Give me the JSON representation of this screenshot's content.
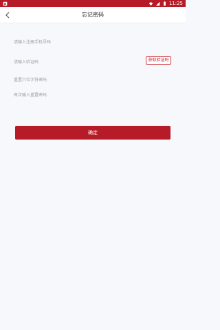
{
  "status_bar": {
    "time": "11:25",
    "colors": {
      "background": "#b51c28"
    },
    "icons": [
      "notification-icon",
      "wifi-icon",
      "signal-icon",
      "battery-icon"
    ]
  },
  "header": {
    "title": "忘记密码"
  },
  "form": {
    "phone_placeholder": "请输入注册手机号码",
    "code_placeholder": "请输入验证码",
    "get_code_label": "获取验证码",
    "new_password_placeholder": "重置六位字符密码",
    "confirm_password_placeholder": "再次输入重置密码",
    "submit_label": "确定"
  },
  "colors": {
    "accent": "#b51c28",
    "page_background": "#f7f8fb"
  }
}
